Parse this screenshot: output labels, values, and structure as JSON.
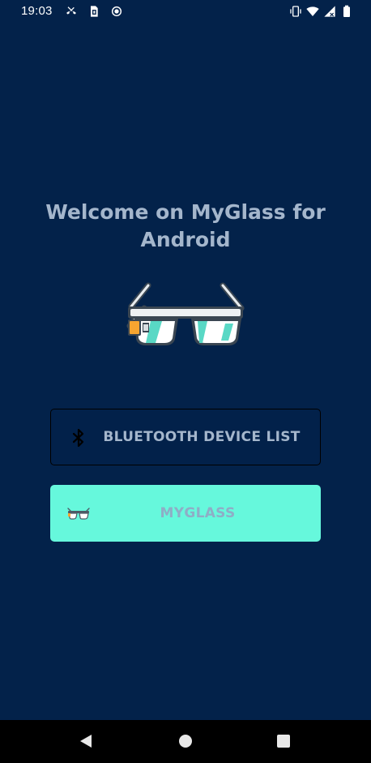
{
  "status_bar": {
    "time": "19:03",
    "left_icons": [
      "missed-call-icon",
      "sim-card-icon",
      "record-icon"
    ],
    "right_icons": [
      "vibrate-icon",
      "wifi-icon",
      "signal-icon",
      "battery-icon"
    ]
  },
  "main": {
    "title": "Welcome on MyGlass for Android",
    "hero_icon": "smart-glasses-icon",
    "buttons": [
      {
        "label": "BLUETOOTH DEVICE LIST",
        "icon": "bluetooth-icon"
      },
      {
        "label": "MYGLASS",
        "icon": "glasses-icon"
      }
    ]
  },
  "nav_bar": {
    "items": [
      "back-icon",
      "home-icon",
      "recents-icon"
    ]
  },
  "colors": {
    "background": "#03224a",
    "title_text": "#a4b6cc",
    "accent_button": "#66f8dc",
    "nav_bar": "#000000"
  }
}
